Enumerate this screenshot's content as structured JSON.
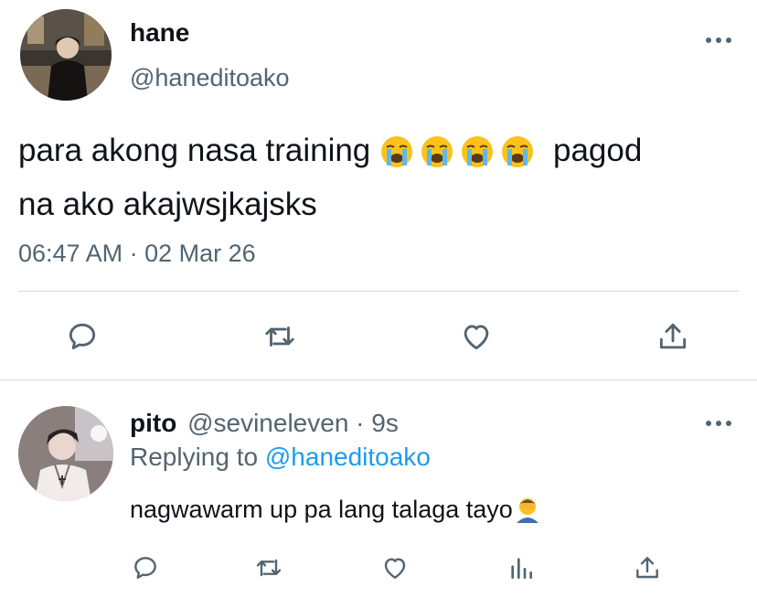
{
  "main_tweet": {
    "display_name": "hane",
    "handle": "@haneditoako",
    "text_before_emoji": "para akong nasa training ",
    "emoji_name": "loudly-crying-face",
    "emoji_count": 4,
    "text_after_emoji": "pagod",
    "text_line2": "na ako akajwsjkajsks",
    "timestamp": "06:47 AM · 02 Mar 26"
  },
  "reply_tweet": {
    "display_name": "pito",
    "handle_time": "@sevineleven · 9s",
    "replying_prefix": "Replying to ",
    "replying_handle": "@haneditoako",
    "text": "nagwawarm up pa lang talaga tayo",
    "trailing_emoji": "person-facepalming"
  },
  "icons": [
    "reply-icon",
    "retweet-icon",
    "like-icon",
    "share-icon",
    "views-icon",
    "more-icon"
  ],
  "colors": {
    "text": "#0f1419",
    "muted": "#536471",
    "accent": "#1d9bf0",
    "divider": "#cfd9de"
  }
}
